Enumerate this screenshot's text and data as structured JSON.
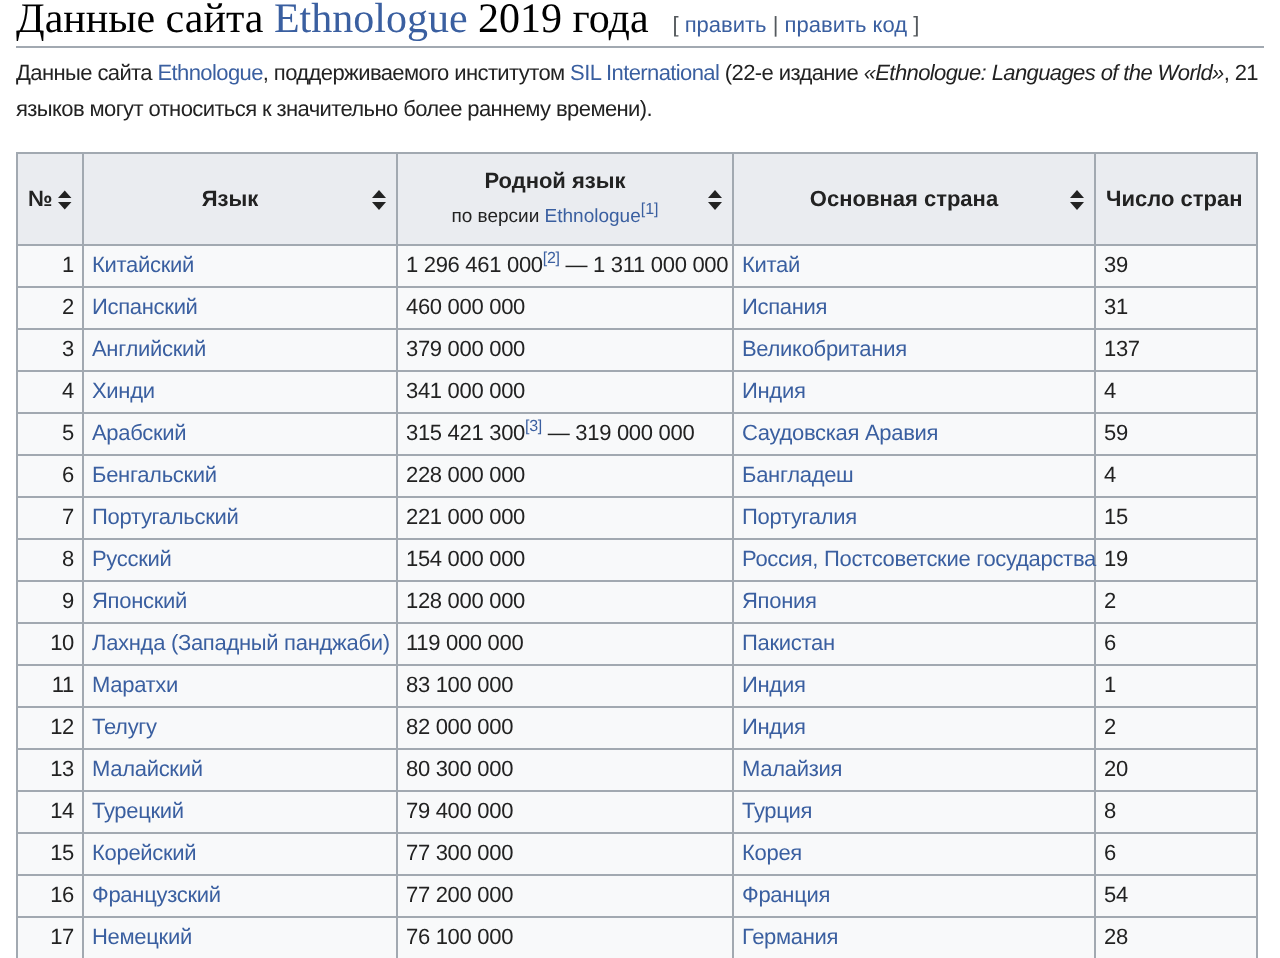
{
  "heading": {
    "parts": [
      {
        "kind": "text",
        "text": "Данные сайта "
      },
      {
        "kind": "link",
        "text": "Ethnologue"
      },
      {
        "kind": "text",
        "text": " 2019 года"
      }
    ],
    "edit_links": {
      "open": "[",
      "links": [
        "править",
        "править код"
      ],
      "separator": "|",
      "close": "]"
    }
  },
  "intro": {
    "lines": [
      [
        {
          "kind": "text",
          "text": "Данные сайта "
        },
        {
          "kind": "link",
          "text": "Ethnologue"
        },
        {
          "kind": "text",
          "text": ", поддерживаемого институтом "
        },
        {
          "kind": "link",
          "text": "SIL International"
        },
        {
          "kind": "text",
          "text": " (22-е издание *«Ethnologue: Languages of the World»*, 21"
        }
      ],
      [
        {
          "kind": "text",
          "text": "языков могут относиться к значительно более раннему времени)."
        }
      ]
    ]
  },
  "table": {
    "columns": [
      {
        "label": "№"
      },
      {
        "label": "Язык"
      },
      {
        "label": "Родной язык",
        "sublabel": "по версии",
        "sublink": "Ethnologue",
        "ref": "[1]"
      },
      {
        "label": "Основная страна"
      },
      {
        "label": "Число стран"
      }
    ],
    "rows": [
      {
        "num": "1",
        "language": "Китайский",
        "speakers": "1 296 461 000$^{[2]}$ — 1 311 000 000",
        "country": "Китай",
        "countries": "39"
      },
      {
        "num": "2",
        "language": "Испанский",
        "speakers": "460 000 000",
        "country": "Испания",
        "countries": "31"
      },
      {
        "num": "3",
        "language": "Английский",
        "speakers": "379 000 000",
        "country": "Великобритания",
        "countries": "137"
      },
      {
        "num": "4",
        "language": "Хинди",
        "speakers": "341 000 000",
        "country": "Индия",
        "countries": "4"
      },
      {
        "num": "5",
        "language": "Арабский",
        "speakers": "315 421 300$^{[3]}$ — 319 000 000",
        "country": "Саудовская Аравия",
        "countries": "59"
      },
      {
        "num": "6",
        "language": "Бенгальский",
        "speakers": "228 000 000",
        "country": "Бангладеш",
        "countries": "4"
      },
      {
        "num": "7",
        "language": "Португальский",
        "speakers": "221 000 000",
        "country": "Португалия",
        "countries": "15"
      },
      {
        "num": "8",
        "language": "Русский",
        "speakers": "154 000 000",
        "country": "Россия, Постсоветские государства",
        "countries": "19"
      },
      {
        "num": "9",
        "language": "Японский",
        "speakers": "128 000 000",
        "country": "Япония",
        "countries": "2"
      },
      {
        "num": "10",
        "language": "Лахнда (Западный панджаби)",
        "speakers": "119 000 000",
        "country": "Пакистан",
        "countries": "6"
      },
      {
        "num": "11",
        "language": "Маратхи",
        "speakers": "83 100 000",
        "country": "Индия",
        "countries": "1"
      },
      {
        "num": "12",
        "language": "Телугу",
        "speakers": "82 000 000",
        "country": "Индия",
        "countries": "2"
      },
      {
        "num": "13",
        "language": "Малайский",
        "speakers": "80 300 000",
        "country": "Малайзия",
        "countries": "20"
      },
      {
        "num": "14",
        "language": "Турецкий",
        "speakers": "79 400 000",
        "country": "Турция",
        "countries": "8"
      },
      {
        "num": "15",
        "language": "Корейский",
        "speakers": "77 300 000",
        "country": "Корея",
        "countries": "6"
      },
      {
        "num": "16",
        "language": "Французский",
        "speakers": "77 200 000",
        "country": "Франция",
        "countries": "54"
      },
      {
        "num": "17",
        "language": "Немецкий",
        "speakers": "76 100 000",
        "country": "Германия",
        "countries": "28"
      }
    ]
  }
}
